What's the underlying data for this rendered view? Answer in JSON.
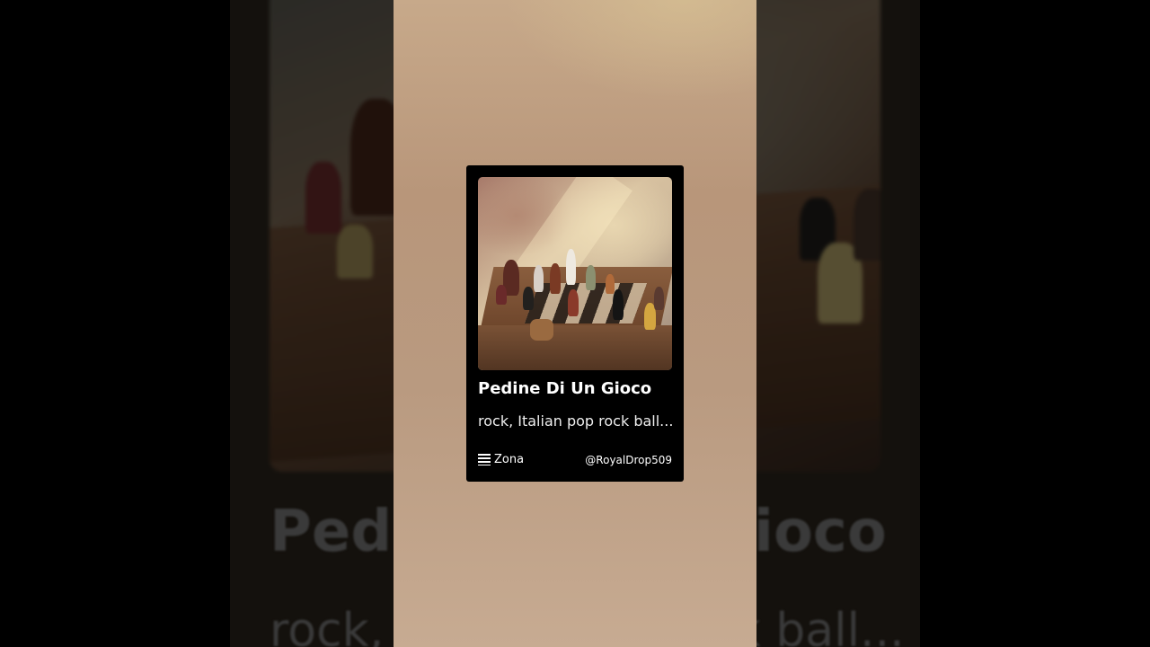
{
  "card": {
    "title": "Pedine Di Un Gioco",
    "subtitle": "rock, Italian pop rock ball...",
    "brand": "Zona",
    "handle": "@RoyalDrop509",
    "cover_icon": "chess-artwork"
  },
  "backdrop": {
    "title": "Pedine Di Un Gioco",
    "subtitle": "rock, Italian pop rock ball..."
  },
  "colors": {
    "panel": "#b99a80",
    "card": "#000000",
    "text": "#ffffff"
  }
}
